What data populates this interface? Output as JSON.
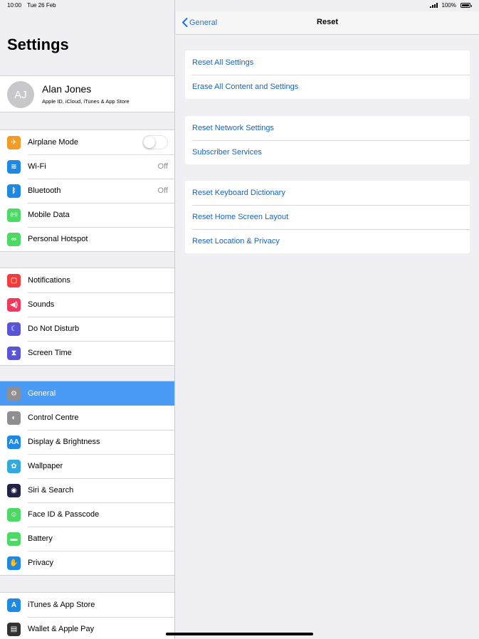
{
  "status_bar": {
    "time": "10:00",
    "date": "Tue 26 Feb",
    "battery": "100%"
  },
  "left": {
    "title": "Settings",
    "profile": {
      "initials": "AJ",
      "name": "Alan Jones",
      "subtitle": "Apple ID, iCloud, iTunes & App Store"
    },
    "groups": [
      [
        {
          "label": "Airplane Mode",
          "icon": "airplane-icon",
          "color": "#f59a23",
          "toggle": true
        },
        {
          "label": "Wi-Fi",
          "icon": "wifi-icon",
          "color": "#1e88e5",
          "value": "Off"
        },
        {
          "label": "Bluetooth",
          "icon": "bluetooth-icon",
          "color": "#1e88e5",
          "value": "Off"
        },
        {
          "label": "Mobile Data",
          "icon": "antenna-icon",
          "color": "#4cd964"
        },
        {
          "label": "Personal Hotspot",
          "icon": "link-icon",
          "color": "#4cd964"
        }
      ],
      [
        {
          "label": "Notifications",
          "icon": "notifications-icon",
          "color": "#f23c3c"
        },
        {
          "label": "Sounds",
          "icon": "speaker-icon",
          "color": "#f2385c"
        },
        {
          "label": "Do Not Disturb",
          "icon": "moon-icon",
          "color": "#5856d6"
        },
        {
          "label": "Screen Time",
          "icon": "hourglass-icon",
          "color": "#5856d6"
        }
      ],
      [
        {
          "label": "General",
          "icon": "gear-icon",
          "color": "#8e8e93",
          "selected": true
        },
        {
          "label": "Control Centre",
          "icon": "toggles-icon",
          "color": "#8e8e93"
        },
        {
          "label": "Display & Brightness",
          "icon": "text-size-icon",
          "color": "#1e88e5"
        },
        {
          "label": "Wallpaper",
          "icon": "flower-icon",
          "color": "#34aadc"
        },
        {
          "label": "Siri & Search",
          "icon": "siri-icon",
          "color": "#222244"
        },
        {
          "label": "Face ID & Passcode",
          "icon": "face-id-icon",
          "color": "#4cd964"
        },
        {
          "label": "Battery",
          "icon": "battery-icon",
          "color": "#4cd964"
        },
        {
          "label": "Privacy",
          "icon": "hand-icon",
          "color": "#1e88e5"
        }
      ],
      [
        {
          "label": "iTunes & App Store",
          "icon": "app-store-icon",
          "color": "#1e88e5"
        },
        {
          "label": "Wallet & Apple Pay",
          "icon": "wallet-icon",
          "color": "#333333"
        }
      ]
    ]
  },
  "right": {
    "back_label": "General",
    "title": "Reset",
    "cards": [
      [
        "Reset All Settings",
        "Erase All Content and Settings"
      ],
      [
        "Reset Network Settings",
        "Subscriber Services"
      ],
      [
        "Reset Keyboard Dictionary",
        "Reset Home Screen Layout",
        "Reset Location & Privacy"
      ]
    ]
  }
}
